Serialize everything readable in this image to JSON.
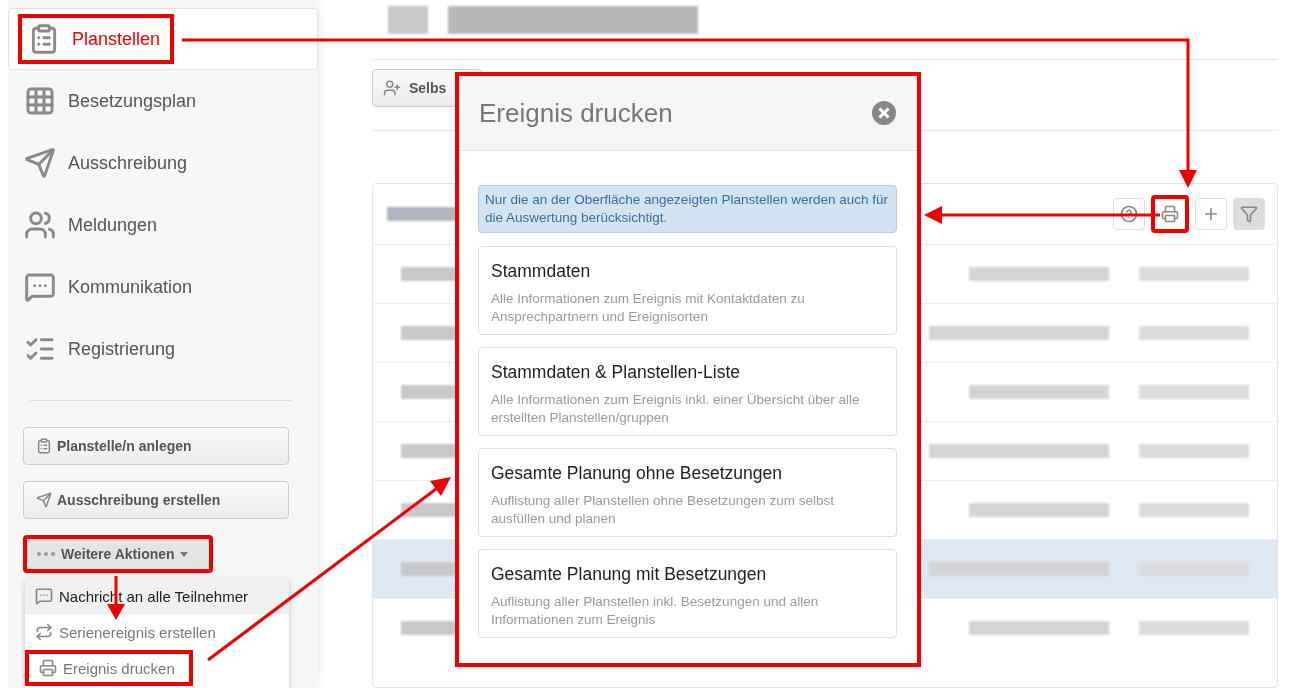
{
  "sidebar": {
    "items": [
      {
        "label": "Planstellen",
        "kind": "clipboard",
        "selected": true,
        "highlighted": true
      },
      {
        "label": "Besetzungsplan",
        "kind": "grid",
        "selected": false,
        "highlighted": false
      },
      {
        "label": "Ausschreibung",
        "kind": "send",
        "selected": false,
        "highlighted": false
      },
      {
        "label": "Meldungen",
        "kind": "users",
        "selected": false,
        "highlighted": false
      },
      {
        "label": "Kommunikation",
        "kind": "chat",
        "selected": false,
        "highlighted": false
      },
      {
        "label": "Registrierung",
        "kind": "checklist",
        "selected": false,
        "highlighted": false
      }
    ],
    "actions": [
      {
        "label": "Planstelle/n anlegen",
        "kind": "clipboard"
      },
      {
        "label": "Ausschreibung erstellen",
        "kind": "send"
      }
    ],
    "more_actions": {
      "label": "Weitere Aktionen",
      "expanded": true,
      "highlighted": true
    },
    "menu": [
      {
        "label": "Nachricht an alle Teilnehmer",
        "kind": "chat",
        "hovered": true,
        "highlighted": false
      },
      {
        "label": "Serienereignis erstellen",
        "kind": "repeat",
        "hovered": false,
        "highlighted": false
      },
      {
        "label": "Ereignis drucken",
        "kind": "printer",
        "hovered": false,
        "highlighted": true
      }
    ]
  },
  "main": {
    "toolbar_button": "Selbs",
    "panel_tools": [
      {
        "kind": "help",
        "highlighted": false,
        "active": false
      },
      {
        "kind": "printer",
        "highlighted": true,
        "active": false
      },
      {
        "kind": "plus",
        "highlighted": false,
        "active": false
      },
      {
        "kind": "filter",
        "highlighted": false,
        "active": true
      }
    ],
    "rows": [
      {
        "kind": "blurred",
        "selected": false
      },
      {
        "kind": "blurred",
        "selected": false
      },
      {
        "kind": "blurred",
        "selected": false
      },
      {
        "kind": "blurred",
        "selected": false
      },
      {
        "kind": "blurred",
        "selected": false
      },
      {
        "kind": "blurred",
        "selected": true
      },
      {
        "kind": "blurred",
        "selected": false
      }
    ]
  },
  "dialog": {
    "title": "Ereignis drucken",
    "highlighted": true,
    "notice": "Nur die an der Oberfläche angezeigten Planstellen werden auch für die Auswertung berücksichtigt.",
    "options": [
      {
        "title": "Stammdaten",
        "description": "Alle Informationen zum Ereignis mit Kontaktdaten zu Ansprechpartnern und Ereignisorten"
      },
      {
        "title": "Stammdaten & Planstellen-Liste",
        "description": "Alle Informationen zum Ereignis inkl. einer Übersicht über alle erstellten Planstellen/gruppen"
      },
      {
        "title": "Gesamte Planung ohne Besetzungen",
        "description": "Auflistung aller Planstellen ohne Besetzungen zum selbst ausfüllen und planen"
      },
      {
        "title": "Gesamte Planung mit Besetzungen",
        "description": "Auflistung aller Planstellen inkl. Besetzungen und allen Informationen zum Ereignis"
      }
    ]
  }
}
